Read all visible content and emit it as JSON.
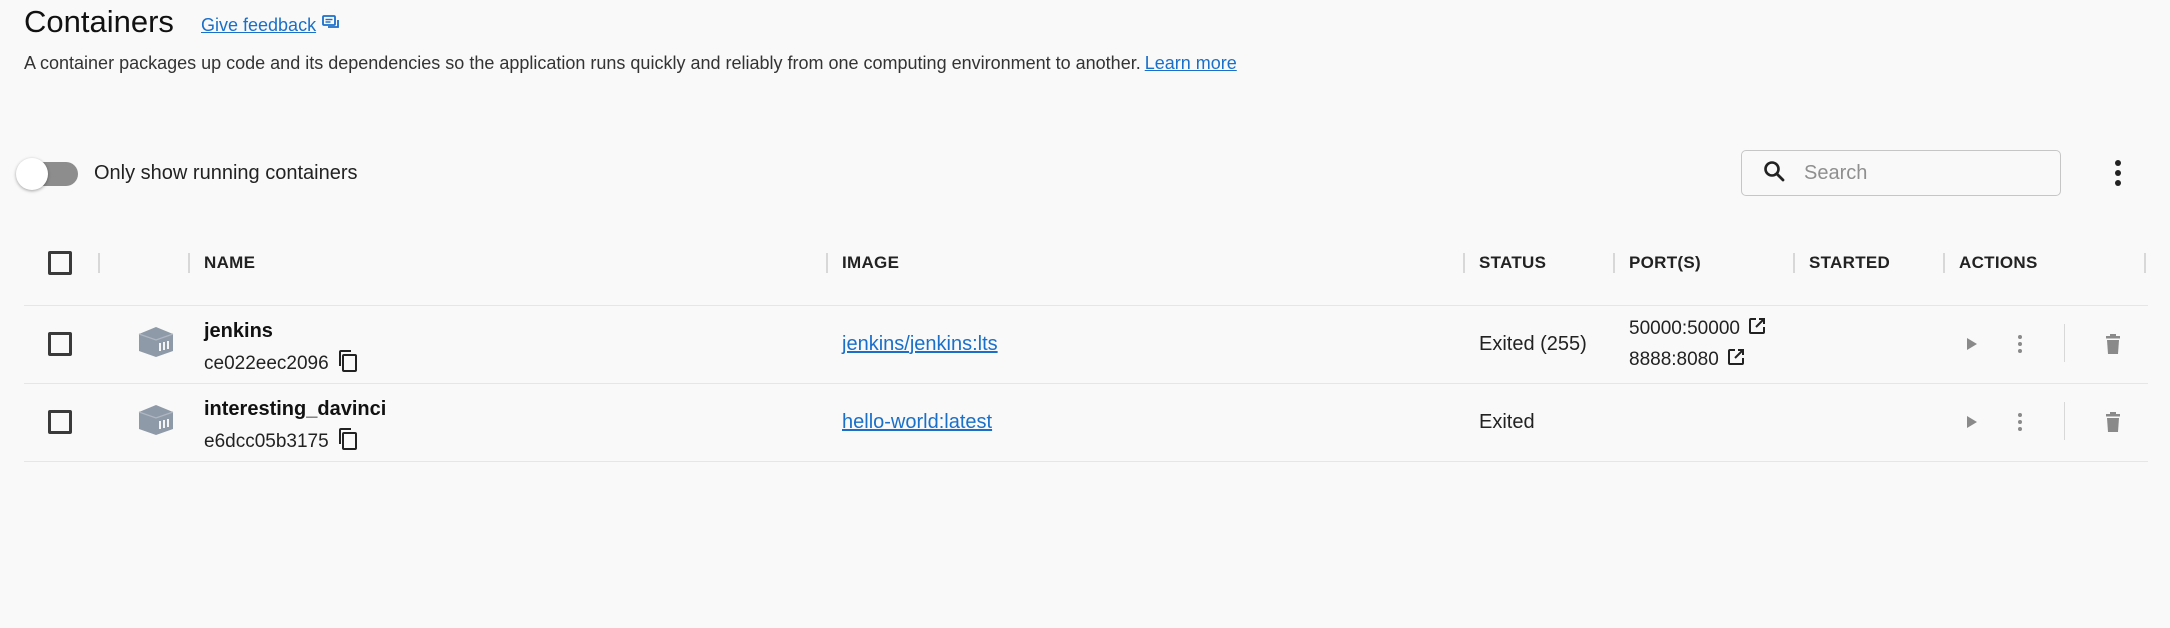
{
  "header": {
    "title": "Containers",
    "feedback_label": "Give feedback",
    "description": "A container packages up code and its dependencies so the application runs quickly and reliably from one computing environment to another.",
    "learn_more": "Learn more"
  },
  "toolbar": {
    "toggle_label": "Only show running containers",
    "toggle_on": false,
    "search_placeholder": "Search"
  },
  "table": {
    "columns": {
      "name": "NAME",
      "image": "IMAGE",
      "status": "STATUS",
      "ports": "PORT(S)",
      "started": "STARTED",
      "actions": "ACTIONS"
    },
    "rows": [
      {
        "name": "jenkins",
        "id": "ce022eec2096",
        "image": "jenkins/jenkins:lts",
        "status": "Exited (255)",
        "ports": [
          "50000:50000",
          "8888:8080"
        ],
        "started": ""
      },
      {
        "name": "interesting_davinci",
        "id": "e6dcc05b3175",
        "image": "hello-world:latest",
        "status": "Exited",
        "ports": [],
        "started": ""
      }
    ]
  },
  "colors": {
    "background": "#f9f9f9",
    "link": "#1a6fc9",
    "container_icon": "#8f9aa8",
    "toggle_off": "#8d8d8d"
  },
  "icons": {
    "feedback": "feedback-icon",
    "search": "search-icon",
    "more": "more-vert-icon",
    "container": "container-icon",
    "copy": "copy-icon",
    "open_external": "open-external-icon",
    "play": "play-icon",
    "delete": "trash-icon"
  }
}
